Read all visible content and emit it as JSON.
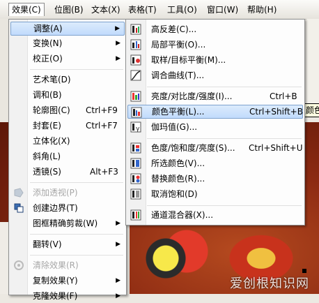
{
  "menubar": {
    "items": [
      {
        "label": "效果(C)",
        "active": true
      },
      {
        "label": "位图(B)"
      },
      {
        "label": "文本(X)"
      },
      {
        "label": "表格(T)"
      },
      {
        "label": "工具(O)"
      },
      {
        "label": "窗口(W)"
      },
      {
        "label": "帮助(H)"
      }
    ]
  },
  "effects_menu": {
    "items": [
      {
        "label": "调整(A)",
        "submenu": true,
        "highlighted": true
      },
      {
        "label": "变换(N)",
        "submenu": true
      },
      {
        "label": "校正(O)",
        "submenu": true
      },
      {
        "label": "艺术笔(D)"
      },
      {
        "label": "调和(B)"
      },
      {
        "label": "轮廓图(C)",
        "shortcut": "Ctrl+F9"
      },
      {
        "label": "封套(E)",
        "shortcut": "Ctrl+F7"
      },
      {
        "label": "立体化(X)"
      },
      {
        "label": "斜角(L)"
      },
      {
        "label": "透镜(S)",
        "shortcut": "Alt+F3"
      },
      {
        "label": "添加透视(P)",
        "disabled": true,
        "icon": "perspective-icon"
      },
      {
        "label": "创建边界(T)",
        "icon": "boundary-icon"
      },
      {
        "label": "图框精确剪裁(W)",
        "submenu": true
      },
      {
        "label": "翻转(V)",
        "submenu": true
      },
      {
        "label": "清除效果(R)",
        "disabled": true,
        "icon": "clear-effect-icon"
      },
      {
        "label": "复制效果(Y)",
        "submenu": true
      },
      {
        "label": "克隆效果(F)",
        "submenu": true
      }
    ]
  },
  "adjust_submenu": {
    "items": [
      {
        "label": "高反差(C)...",
        "icon": "high-contrast-icon"
      },
      {
        "label": "局部平衡(O)...",
        "icon": "local-equalization-icon"
      },
      {
        "label": "取样/目标平衡(M)...",
        "icon": "sample-target-balance-icon"
      },
      {
        "label": "调合曲线(T)...",
        "icon": "tone-curve-icon"
      },
      {
        "label": "亮度/对比度/强度(I)...",
        "shortcut": "Ctrl+B",
        "icon": "brightness-contrast-icon"
      },
      {
        "label": "颜色平衡(L)...",
        "shortcut": "Ctrl+Shift+B",
        "icon": "color-balance-icon",
        "highlighted": true
      },
      {
        "label": "伽玛值(G)...",
        "icon": "gamma-icon"
      },
      {
        "label": "色度/饱和度/亮度(S)...",
        "shortcut": "Ctrl+Shift+U",
        "icon": "hue-saturation-icon"
      },
      {
        "label": "所选颜色(V)...",
        "icon": "selective-color-icon"
      },
      {
        "label": "替换颜色(R)...",
        "icon": "replace-color-icon"
      },
      {
        "label": "取消饱和(D)",
        "icon": "desaturate-icon"
      },
      {
        "label": "通道混合器(X)...",
        "icon": "channel-mixer-icon"
      }
    ]
  },
  "tooltip": {
    "text": "颜色"
  },
  "watermark": {
    "text": "爱创根知识网"
  }
}
